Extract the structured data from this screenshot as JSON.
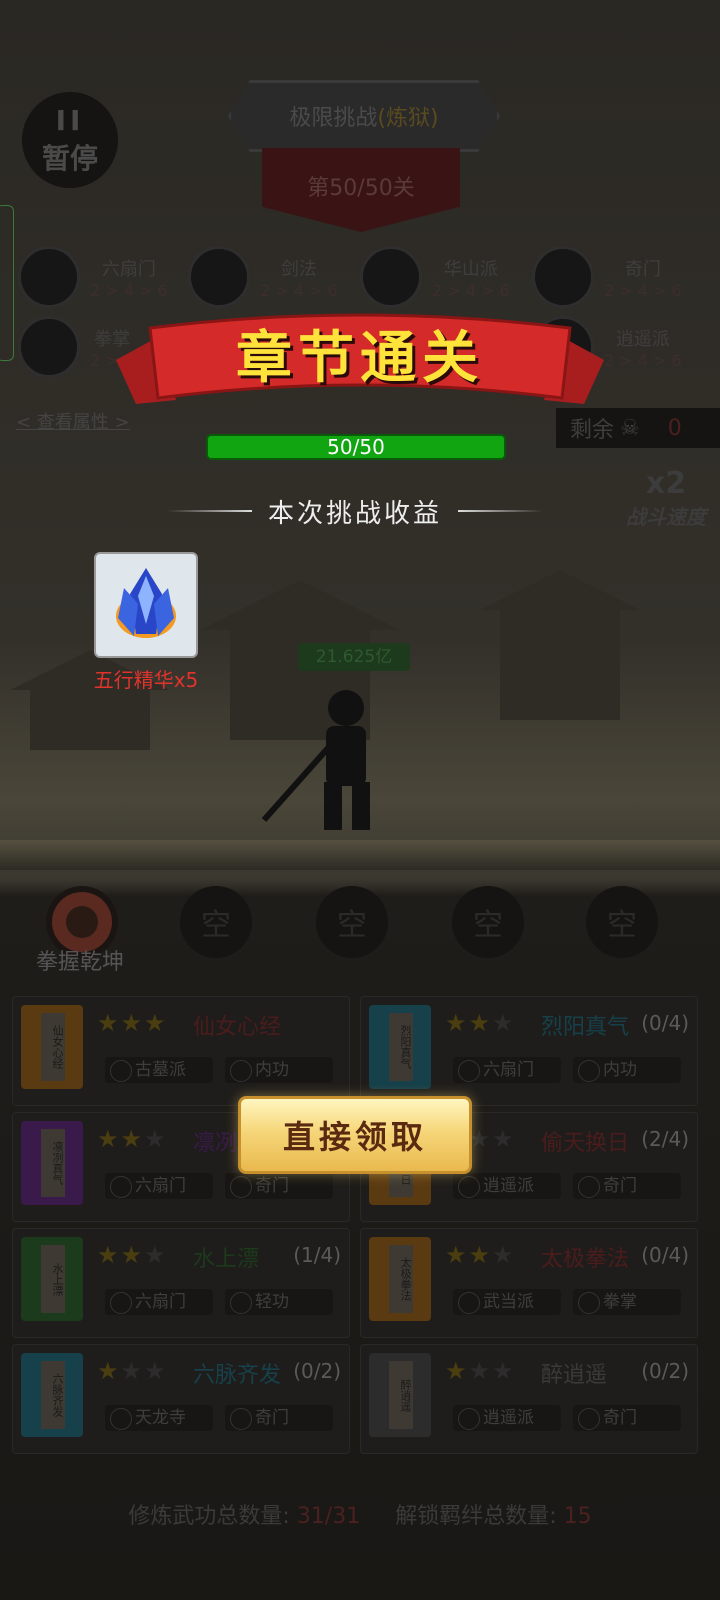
{
  "top": {
    "pause_label": "暂停",
    "pause_bars": "II",
    "mode_title": "极限挑战",
    "mode_sub": "(炼狱)",
    "level": "第50/50关"
  },
  "factions": [
    {
      "name": "六扇门",
      "levels": "2 > 4 > 6",
      "icon": "liushanmen-icon"
    },
    {
      "name": "剑法",
      "levels": "2 > 4 > 6",
      "icon": "sword-icon"
    },
    {
      "name": "华山派",
      "levels": "2 > 4 > 6",
      "icon": "huashan-icon"
    },
    {
      "name": "奇门",
      "levels": "2 > 4 > 6",
      "icon": "qimen-icon"
    },
    {
      "name": "拳掌",
      "levels": "2 > 4",
      "icon": "fist-icon"
    },
    {
      "name": "逍遥派",
      "levels": "2 > 4 > 6",
      "icon": "xiaoyao-icon"
    }
  ],
  "view_attributes": "< 查看属性 >",
  "remaining": {
    "label": "剩余",
    "count": "0"
  },
  "speed": {
    "multiplier": "x2",
    "label": "战斗速度"
  },
  "popup": {
    "title": "章节通关",
    "progress_text": "50/50",
    "progress_fraction": 1.0,
    "rewards_title": "本次挑战收益",
    "reward_item": "五行精华x5",
    "claim_button": "直接领取"
  },
  "enemy_hp": "21.625亿",
  "skill_slots": {
    "first_label": "拳握乾坤",
    "empty": "空"
  },
  "skills": [
    {
      "name": "仙女心经",
      "count": "",
      "stars": 3,
      "name_color": "#4a1c1c",
      "book_color": "#5a3a10",
      "book_text": "仙女心经",
      "tags": [
        "古墓派",
        "内功"
      ]
    },
    {
      "name": "烈阳真气",
      "count": "(0/4)",
      "stars": 2,
      "name_color": "#16404a",
      "book_color": "#16404a",
      "book_text": "烈阳真气",
      "tags": [
        "六扇门",
        "内功"
      ]
    },
    {
      "name": "凛冽",
      "count": "",
      "stars": 2,
      "name_color": "#3a1a4a",
      "book_color": "#3a1a4a",
      "book_text": "凛冽真气",
      "tags": [
        "六扇门",
        "奇门"
      ]
    },
    {
      "name": "偷天换日",
      "count": "(2/4)",
      "stars": 1,
      "name_color": "#4a1c1c",
      "book_color": "#5a3a10",
      "book_text": "偷天换日",
      "tags": [
        "逍遥派",
        "奇门"
      ]
    },
    {
      "name": "水上漂",
      "count": "(1/4)",
      "stars": 2,
      "name_color": "#1c3a1c",
      "book_color": "#1c3a1c",
      "book_text": "水上漂",
      "tags": [
        "六扇门",
        "轻功"
      ]
    },
    {
      "name": "太极拳法",
      "count": "(0/4)",
      "stars": 2,
      "name_color": "#4a1c1c",
      "book_color": "#5a3a10",
      "book_text": "太极拳法",
      "tags": [
        "武当派",
        "拳掌"
      ]
    },
    {
      "name": "六脉齐发",
      "count": "(0/2)",
      "stars": 1,
      "name_color": "#16404a",
      "book_color": "#16404a",
      "book_text": "六脉齐发",
      "tags": [
        "天龙寺",
        "奇门"
      ]
    },
    {
      "name": "醉逍遥",
      "count": "(0/2)",
      "stars": 1,
      "name_color": "#3a3a3a",
      "book_color": "#2c2c2c",
      "book_text": "醉逍遥",
      "tags": [
        "逍遥派",
        "奇门"
      ]
    }
  ],
  "footer": {
    "learned_label": "修炼武功总数量:",
    "learned_value": "31/31",
    "bonds_label": "解锁羁绊总数量:",
    "bonds_value": "15"
  }
}
